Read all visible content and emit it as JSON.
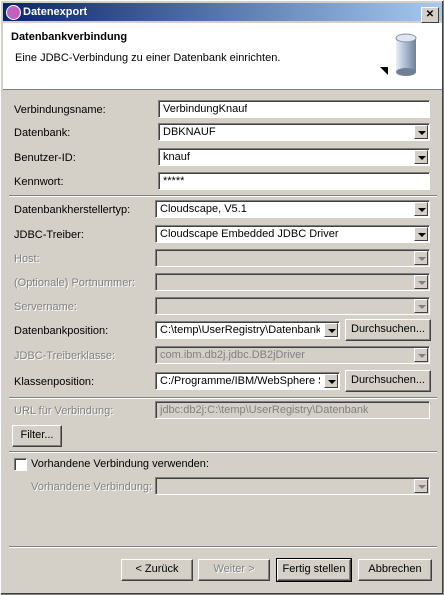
{
  "window": {
    "title": "Datenexport"
  },
  "header": {
    "title": "Datenbankverbindung",
    "description": "Eine JDBC-Verbindung zu einer Datenbank einrichten."
  },
  "form": {
    "verbindungsname": {
      "label": "Verbindungsname:",
      "value": "VerbindungKnauf"
    },
    "datenbank": {
      "label": "Datenbank:",
      "value": "DBKNAUF"
    },
    "benutzer": {
      "label": "Benutzer-ID:",
      "value": "knauf"
    },
    "kennwort": {
      "label": "Kennwort:",
      "value": "*****"
    },
    "hersteller": {
      "label": "Datenbankherstellertyp:",
      "value": "Cloudscape, V5.1"
    },
    "treiber": {
      "label": "JDBC-Treiber:",
      "value": "Cloudscape Embedded JDBC Driver"
    },
    "host": {
      "label": "Host:",
      "value": ""
    },
    "port": {
      "label": "(Optionale) Portnummer:",
      "value": ""
    },
    "servername": {
      "label": "Servername:",
      "value": ""
    },
    "position": {
      "label": "Datenbankposition:",
      "value": "C:\\temp\\UserRegistry\\Datenbank",
      "browse": "Durchsuchen..."
    },
    "treiberklasse": {
      "label": "JDBC-Treiberklasse:",
      "value": "com.ibm.db2j.jdbc.DB2jDriver"
    },
    "klassenposition": {
      "label": "Klassenposition:",
      "value": "C:/Programme/IBM/WebSphere Studio",
      "browse": "Durchsuchen..."
    },
    "url": {
      "label": "URL für Verbindung:",
      "value": "jdbc:db2j:C:\\temp\\UserRegistry\\Datenbank"
    },
    "filter": {
      "label": "Filter..."
    },
    "vorhanden_check": {
      "label": "Vorhandene Verbindung verwenden:"
    },
    "vorhanden": {
      "label": "Vorhandene Verbindung:",
      "value": ""
    }
  },
  "footer": {
    "back": "< Zurück",
    "next": "Weiter >",
    "finish": "Fertig stellen",
    "cancel": "Abbrechen"
  }
}
